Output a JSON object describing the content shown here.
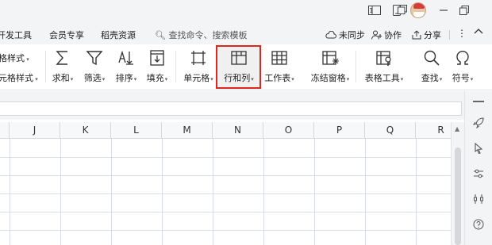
{
  "titlebar": {
    "icons": [
      "split-screen-icon",
      "tablet-icon",
      "restore-icon",
      "avatar",
      "minimize-icon",
      "maximize-icon"
    ]
  },
  "menubar": {
    "items": [
      "开发工具",
      "会员专享",
      "稻壳资源"
    ],
    "search_placeholder": "查找命令、搜索模板",
    "sync_label": "未同步",
    "collab_label": "协作",
    "share_label": "分享"
  },
  "ribbon": {
    "left_labels": [
      "格样式",
      "元格样式"
    ],
    "buttons": [
      {
        "label": "求和",
        "icon": "sum-icon"
      },
      {
        "label": "筛选",
        "icon": "filter-icon"
      },
      {
        "label": "排序",
        "icon": "sort-icon"
      },
      {
        "label": "填充",
        "icon": "fill-icon"
      },
      {
        "label": "单元格",
        "icon": "cell-icon"
      },
      {
        "label": "行和列",
        "icon": "row-col-icon"
      },
      {
        "label": "工作表",
        "icon": "worksheet-icon"
      },
      {
        "label": "冻结窗格",
        "icon": "freeze-panes-icon"
      },
      {
        "label": "表格工具",
        "icon": "table-tools-icon"
      },
      {
        "label": "查找",
        "icon": "find-icon"
      },
      {
        "label": "符号",
        "icon": "symbol-icon"
      }
    ],
    "highlight_color": "#e0251d"
  },
  "grid": {
    "columns": [
      "J",
      "K",
      "L",
      "M",
      "N",
      "O",
      "P",
      "Q",
      "R"
    ]
  },
  "sidepanel": {
    "icons": [
      "rocket-icon",
      "cursor-icon",
      "settings-slider-icon",
      "tools-icon",
      "help-icon"
    ]
  }
}
